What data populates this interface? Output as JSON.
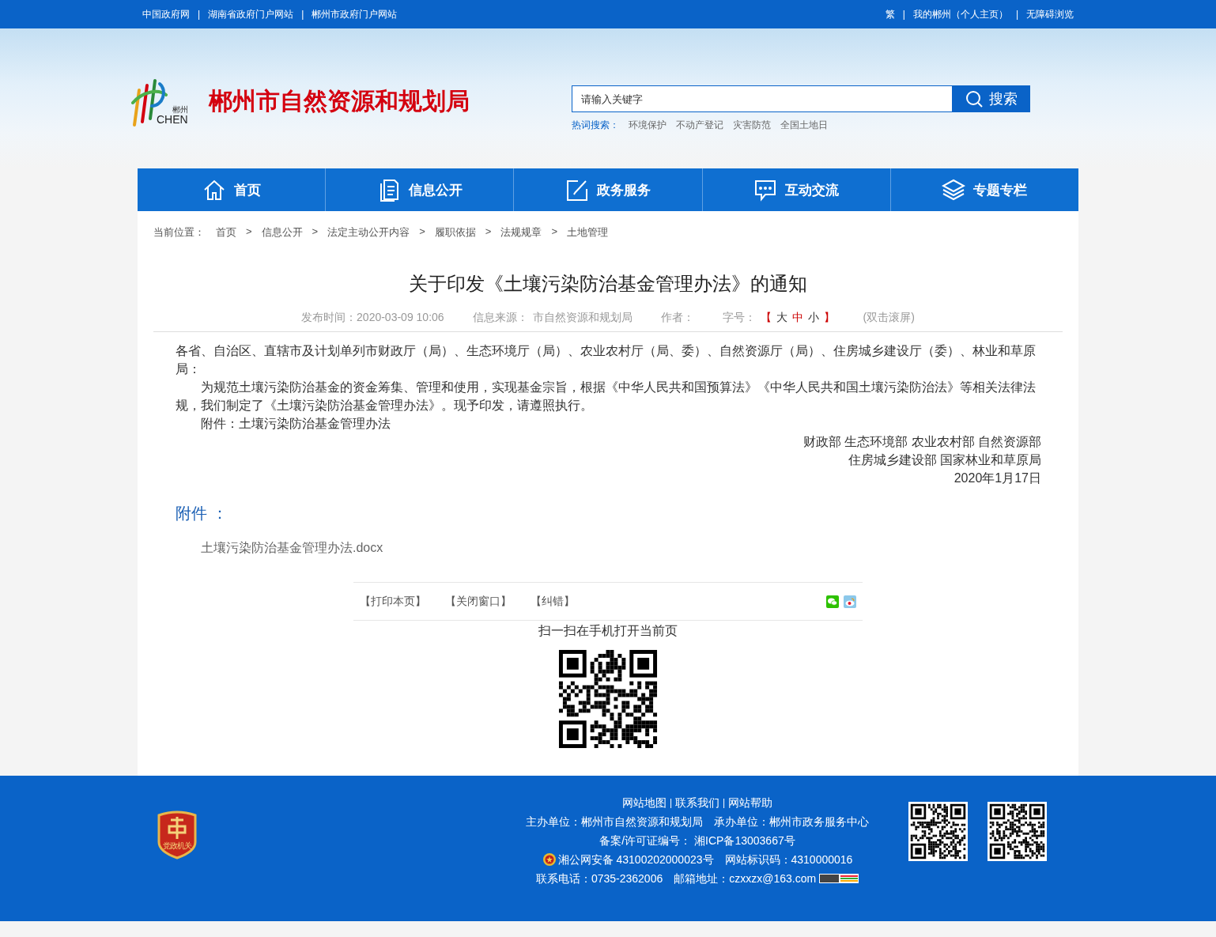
{
  "top_bar": {
    "separator": "|",
    "left_links": [
      "中国政府网",
      "湖南省政府门户网站",
      "郴州市政府门户网站"
    ],
    "right_links": [
      "繁",
      "我的郴州（个人主页）",
      "无障碍浏览"
    ]
  },
  "header": {
    "logo": {
      "text_cn": "郴州",
      "text_en": "CHEN"
    },
    "site_title": "郴州市自然资源和规划局",
    "search": {
      "placeholder": "请输入关键字",
      "button": "搜索"
    },
    "hot_search": {
      "label": "热词搜索：",
      "terms": [
        "环境保护",
        "不动产登记",
        "灾害防范",
        "全国土地日"
      ]
    }
  },
  "nav": [
    {
      "label": "首页"
    },
    {
      "label": "信息公开"
    },
    {
      "label": "政务服务"
    },
    {
      "label": "互动交流"
    },
    {
      "label": "专题专栏"
    }
  ],
  "breadcrumb": {
    "label": "当前位置：",
    "separator": ">",
    "items": [
      "首页",
      "信息公开",
      "法定主动公开内容",
      "履职依据",
      "法规规章",
      "土地管理"
    ]
  },
  "article": {
    "title": "关于印发《土壤污染防治基金管理办法》的通知",
    "meta": {
      "published": "发布时间：2020-03-09 10:06",
      "source_label": "信息来源：",
      "source": "市自然资源和规划局",
      "author_label": "作者：",
      "font_size_label": "字号：",
      "bracket_open": "【",
      "bracket_close": "】",
      "sizes": [
        {
          "label": "大",
          "selected": false
        },
        {
          "label": "中",
          "selected": true
        },
        {
          "label": "小",
          "selected": false
        }
      ],
      "scroll_hint": "(双击滚屏)"
    },
    "paragraphs": [
      {
        "text": "各省、自治区、直辖市及计划单列市财政厅（局）、生态环境厅（局）、农业农村厅（局、委）、自然资源厅（局）、住房城乡建设厅（委）、林业和草原局：",
        "indent": false
      },
      {
        "text": "为规范土壤污染防治基金的资金筹集、管理和使用，实现基金宗旨，根据《中华人民共和国预算法》《中华人民共和国土壤污染防治法》等相关法律法规，我们制定了《土壤污染防治基金管理办法》。现予印发，请遵照执行。",
        "indent": true
      },
      {
        "text": "附件：土壤污染防治基金管理办法",
        "indent": true
      }
    ],
    "signature": [
      "财政部 生态环境部 农业农村部 自然资源部",
      "住房城乡建设部 国家林业和草原局",
      "2020年1月17日"
    ],
    "attachments": {
      "heading": "附件 ：",
      "files": [
        "土壤污染防治基金管理办法.docx"
      ]
    }
  },
  "tools": {
    "links": [
      "【打印本页】",
      "【关闭窗口】",
      "【纠错】"
    ],
    "qr_caption": "扫一扫在手机打开当前页"
  },
  "footer": {
    "badge": "党政机关",
    "separator": "|",
    "links": [
      "网站地图",
      "联系我们",
      "网站帮助"
    ],
    "sponsor": "主办单位：郴州市自然资源和规划局　承办单位：郴州市政务服务中心",
    "icp": "备案/许可证编号： 湘ICP备13003667号",
    "police": "湘公网安备 43100202000023号",
    "site_code": "网站标识码：4310000016",
    "contact": "联系电话：0735-2362006　邮箱地址：czxxzx@163.com"
  }
}
